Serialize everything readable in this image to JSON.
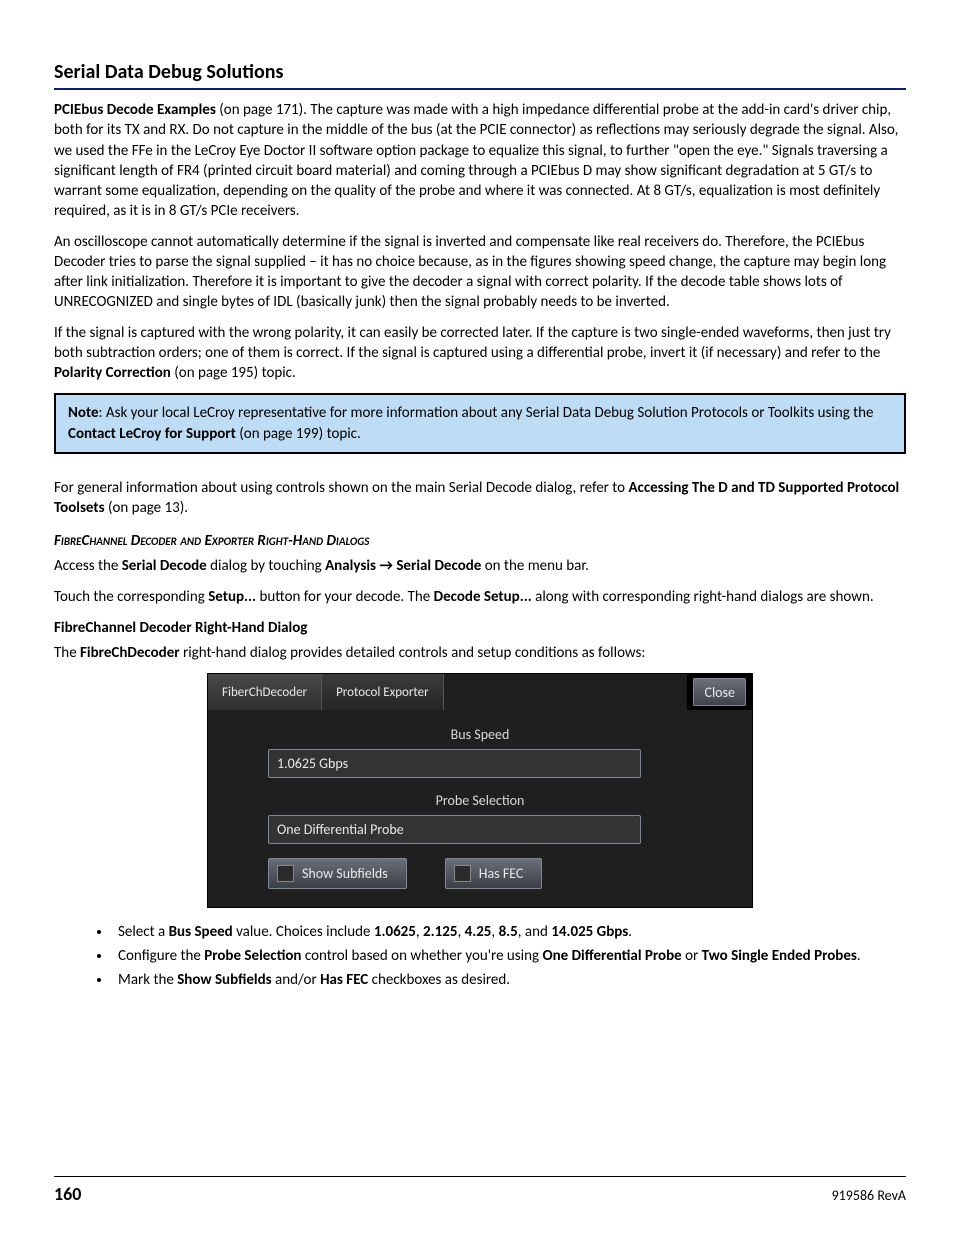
{
  "title": "Serial Data Debug Solutions",
  "p1_a": "PCIEbus Decode Examples",
  "p1_b": " (on page 171). The capture was made with a high impedance differential probe at the add-in card's driver chip, both for its TX and RX. Do not capture in the middle of the bus (at the PCIE connector) as reflections may seriously degrade the signal. Also, we used the FFe in the LeCroy Eye Doctor II software option package to equalize this signal, to further \"open the eye.\" Signals traversing a significant length of FR4 (printed circuit board material) and coming through a PCIEbus D may show significant degradation at 5 GT/s to warrant some equalization, depending on the quality of the probe and where it was connected. At 8 GT/s, equalization is most definitely required, as it is in 8 GT/s PCIe receivers.",
  "p2": "An oscilloscope cannot automatically determine if the signal is inverted and compensate like real receivers do. Therefore, the PCIEbus Decoder tries to parse the signal supplied – it has no choice because, as in the figures showing speed change, the capture may begin long after link initialization. Therefore it is important to give the decoder a signal with correct polarity. If the decode table shows lots of UNRECOGNIZED and single bytes of IDL (basically junk) then the signal probably needs to be inverted.",
  "p3_a": "If the signal is captured with the wrong polarity, it can easily be corrected later. If the capture is two single-ended waveforms, then just try both subtraction orders; one of them is correct. If the signal is captured using a differential probe, invert it (if necessary) and refer to the ",
  "p3_b": "Polarity Correction",
  "p3_c": " (on page 195) topic.",
  "note_a": "Note",
  "note_b": ": Ask your local LeCroy representative for more information about any Serial Data Debug Solution Protocols or Toolkits using the ",
  "note_c": "Contact LeCroy for Support",
  "note_d": " (on page 199) topic.",
  "p4_a": "For general information about using controls shown on the main Serial Decode dialog, refer to ",
  "p4_b": "Accessing The D and TD Supported Protocol Toolsets",
  "p4_c": " (on page 13).",
  "sect_h": "FibreChannel Decoder and Exporter Right-Hand Dialogs",
  "p5_a": "Access the ",
  "p5_b": "Serial Decode",
  "p5_c": " dialog by touching ",
  "p5_d": "Analysis → Serial Decode",
  "p5_e": " on the menu bar.",
  "p6_a": "Touch the corresponding ",
  "p6_b": "Setup...",
  "p6_c": " button for your decode. The ",
  "p6_d": "Decode Setup...",
  "p6_e": " along with corresponding right-hand dialogs are shown.",
  "sub_h": "FibreChannel Decoder Right-Hand Dialog",
  "p7_a": "The ",
  "p7_b": "FibreChDecoder",
  "p7_c": " right-hand dialog provides detailed controls and setup conditions as follows:",
  "dlg": {
    "tab1": "FiberChDecoder",
    "tab2": "Protocol Exporter",
    "close": "Close",
    "lbl_bus": "Bus Speed",
    "val_bus": "1.0625 Gbps",
    "lbl_probe": "Probe Selection",
    "val_probe": "One Differential Probe",
    "chk1": "Show Subfields",
    "chk2": "Has FEC"
  },
  "b1_a": "Select a ",
  "b1_b": "Bus Speed",
  "b1_c": " value. Choices include ",
  "b1_d": "1.0625",
  "b1_e": ", ",
  "b1_f": "2.125",
  "b1_g": ", ",
  "b1_h": "4.25",
  "b1_i": ", ",
  "b1_j": "8.5",
  "b1_k": ", and ",
  "b1_l": "14.025 Gbps",
  "b1_m": ".",
  "b2_a": "Configure the ",
  "b2_b": "Probe Selection",
  "b2_c": " control based on whether you're using ",
  "b2_d": "One Differential Probe",
  "b2_e": " or ",
  "b2_f": "Two Single Ended Probes",
  "b2_g": ".",
  "b3_a": "Mark the ",
  "b3_b": "Show Subfields",
  "b3_c": " and/or ",
  "b3_d": "Has FEC",
  "b3_e": " checkboxes as desired.",
  "page_num": "160",
  "rev": "919586 RevA"
}
